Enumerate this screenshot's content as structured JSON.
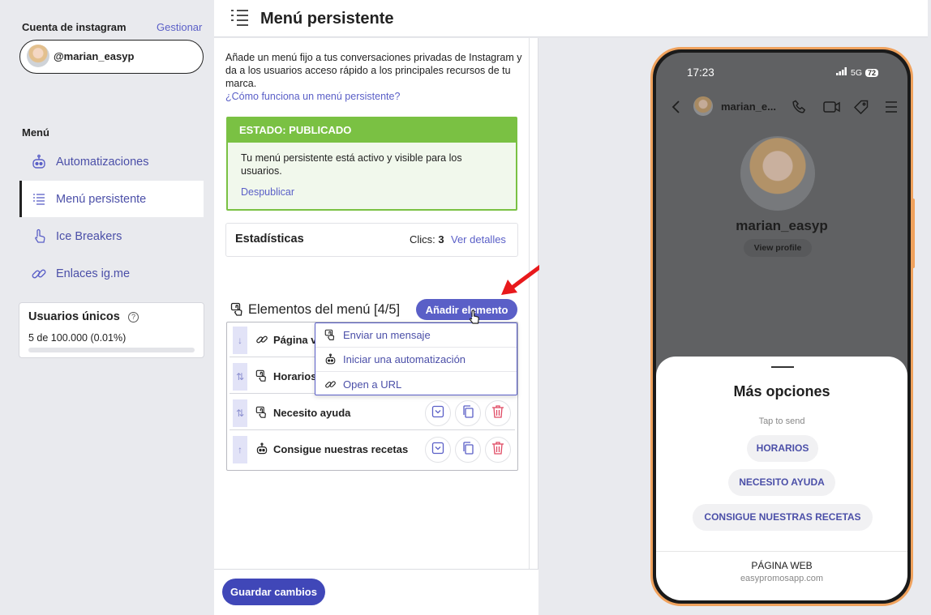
{
  "sidebar": {
    "account_label": "Cuenta de instagram",
    "manage_link": "Gestionar",
    "account_handle": "@marian_easyp",
    "menu_heading": "Menú",
    "items": [
      {
        "label": "Automatizaciones",
        "icon": "robot-icon"
      },
      {
        "label": "Menú persistente",
        "icon": "list-icon",
        "active": true
      },
      {
        "label": "Ice Breakers",
        "icon": "pointer-hand-icon"
      },
      {
        "label": "Enlaces ig.me",
        "icon": "link-icon"
      }
    ],
    "unique_users": {
      "title": "Usuarios únicos",
      "value": "5 de 100.000 (0.01%)",
      "progress": 0.0001
    }
  },
  "header": {
    "title": "Menú persistente"
  },
  "main": {
    "description": "Añade un menú fijo a tus conversaciones privadas de Instagram y da a los usuarios acceso rápido a los principales recursos de tu marca.",
    "help_link": "¿Cómo funciona un menú persistente?",
    "status": {
      "heading": "ESTADO: PUBLICADO",
      "text": "Tu menú persistente está activo y visible para los usuarios.",
      "action": "Despublicar",
      "color": "#7ac143"
    },
    "stats": {
      "title": "Estadísticas",
      "clicks_label": "Clics:",
      "clicks_value": "3",
      "details_link": "Ver detalles"
    },
    "elements": {
      "title": "Elementos del menú [4/5]",
      "add_button": "Añadir elemento",
      "rows": [
        {
          "label": "Página v",
          "icon": "link-icon",
          "handle": "↓"
        },
        {
          "label": "Horarios",
          "icon": "message-icon",
          "handle": "⇅"
        },
        {
          "label": "Necesito ayuda",
          "icon": "message-icon",
          "handle": "⇅"
        },
        {
          "label": "Consigue nuestras recetas",
          "icon": "robot-icon",
          "handle": "↑"
        }
      ],
      "dropdown": [
        {
          "label": "Enviar un mensaje",
          "icon": "message-icon"
        },
        {
          "label": "Iniciar una automatización",
          "icon": "robot-icon"
        },
        {
          "label": "Open a URL",
          "icon": "link-icon"
        }
      ]
    },
    "save_button": "Guardar cambios"
  },
  "preview": {
    "time": "17:23",
    "network": "5G",
    "battery": "72",
    "chat_name": "marian_e...",
    "profile_name": "marian_easyp",
    "view_profile": "View profile",
    "sheet_title": "Más opciones",
    "tap_to_send": "Tap to send",
    "options": [
      "HORARIOS",
      "NECESITO AYUDA",
      "CONSIGUE NUESTRAS RECETAS"
    ],
    "web_title": "PÁGINA WEB",
    "web_url": "easypromosapp.com"
  },
  "colors": {
    "accent": "#5a5fc7",
    "status_green": "#7ac143",
    "phone_frame": "#f0a25d",
    "delete_red": "#e04a64",
    "pointer_arrow": "#e8191c"
  }
}
